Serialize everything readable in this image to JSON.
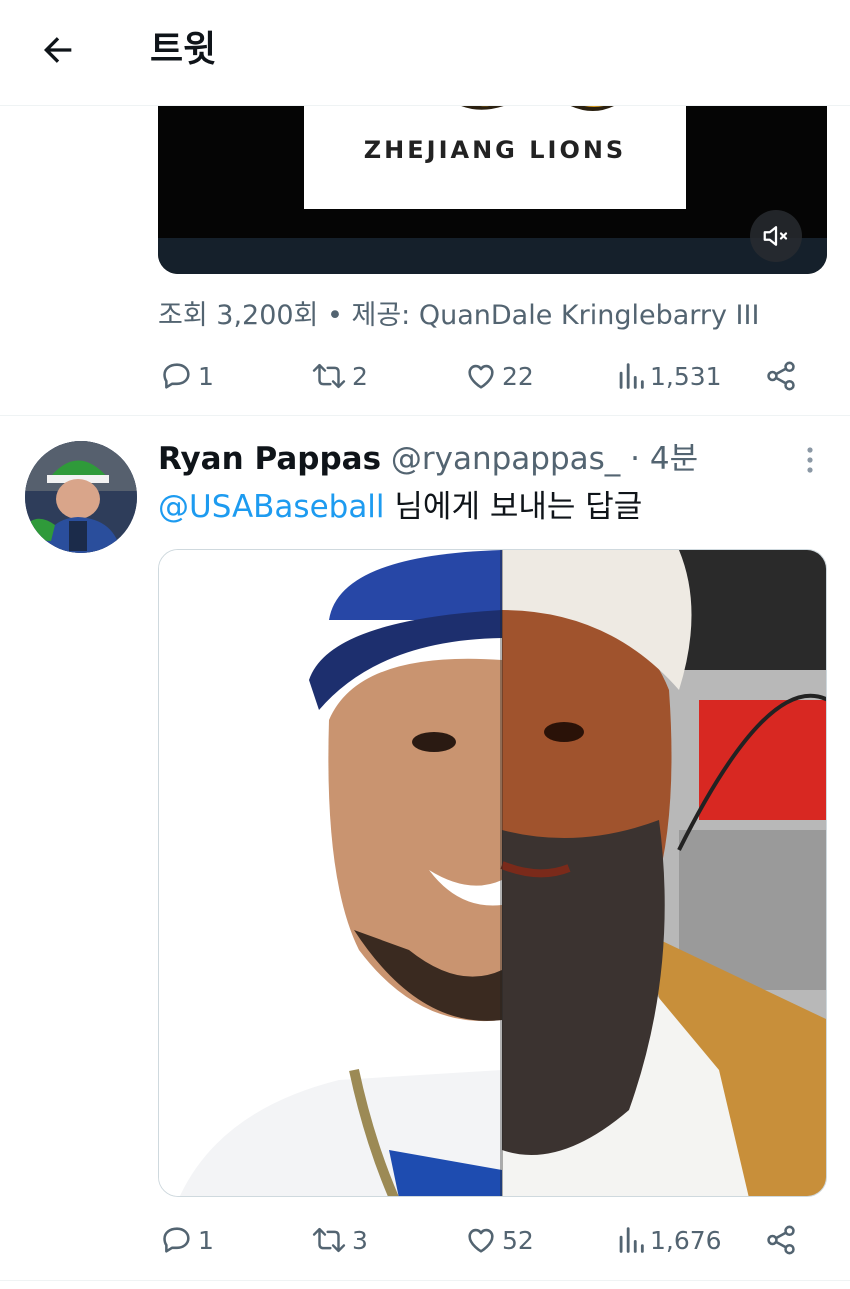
{
  "header": {
    "title": "트윗"
  },
  "tweet1": {
    "video_logo_text": "ZHEJIANG LIONS",
    "views_line": "조회 3,200회 • 제공: QuanDale Kringlebarry III",
    "actions": {
      "replies": "1",
      "retweets": "2",
      "likes": "22",
      "views": "1,531"
    }
  },
  "tweet2": {
    "author_name": "Ryan Pappas",
    "author_handle": "@ryanpappas_ · 4분",
    "reply_mention": "@USABaseball",
    "reply_suffix": " 님에게 보내는 답글",
    "actions": {
      "replies": "1",
      "retweets": "3",
      "likes": "52",
      "views": "1,676"
    }
  },
  "colors": {
    "accent": "#1d9bf0",
    "secondary_text": "#536471",
    "divider": "#eff3f4"
  },
  "icons": [
    "back-arrow-icon",
    "mute-icon",
    "reply-icon",
    "retweet-icon",
    "like-icon",
    "views-icon",
    "share-icon",
    "more-icon"
  ]
}
